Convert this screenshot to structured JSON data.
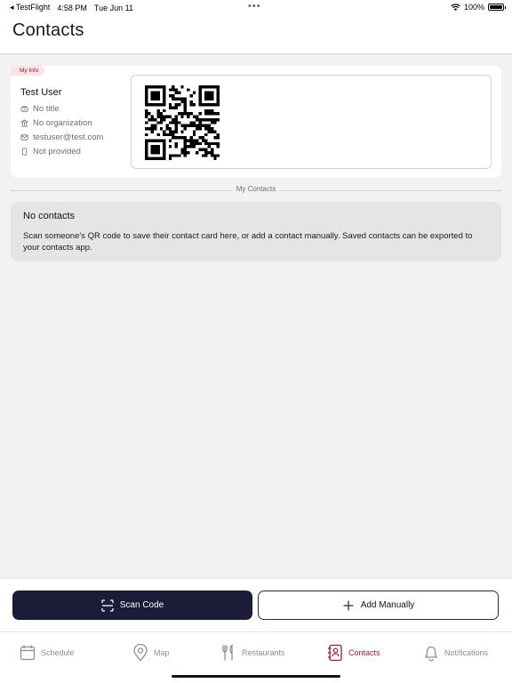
{
  "status_bar": {
    "back_app": "TestFlight",
    "time": "4:58 PM",
    "date": "Tue Jun 11",
    "battery": "100%",
    "battery_level": 1.0
  },
  "header": {
    "title": "Contacts"
  },
  "my_info": {
    "tag": "My Info",
    "name": "Test User",
    "title": "No title",
    "organization": "No organization",
    "email": "testuser@test.com",
    "phone": "Not provided"
  },
  "contacts_section": {
    "label": "My Contacts"
  },
  "empty_state": {
    "title": "No contacts",
    "message": "Scan someone's QR code to save their contact card here, or add a contact manually. Saved contacts can be exported to your contacts app."
  },
  "actions": {
    "scan_label": "Scan Code",
    "add_label": "Add Manually"
  },
  "tabs": [
    {
      "label": "Schedule",
      "icon": "calendar-icon"
    },
    {
      "label": "Map",
      "icon": "map-pin-icon"
    },
    {
      "label": "Restaurants",
      "icon": "fork-knife-icon"
    },
    {
      "label": "Contacts",
      "icon": "contact-book-icon"
    },
    {
      "label": "Notifications",
      "icon": "bell-icon"
    }
  ],
  "active_tab": "Contacts",
  "colors": {
    "accent": "#9b1b2c",
    "primary_button": "#1c1c38",
    "tag_background": "#fbe3e6"
  }
}
